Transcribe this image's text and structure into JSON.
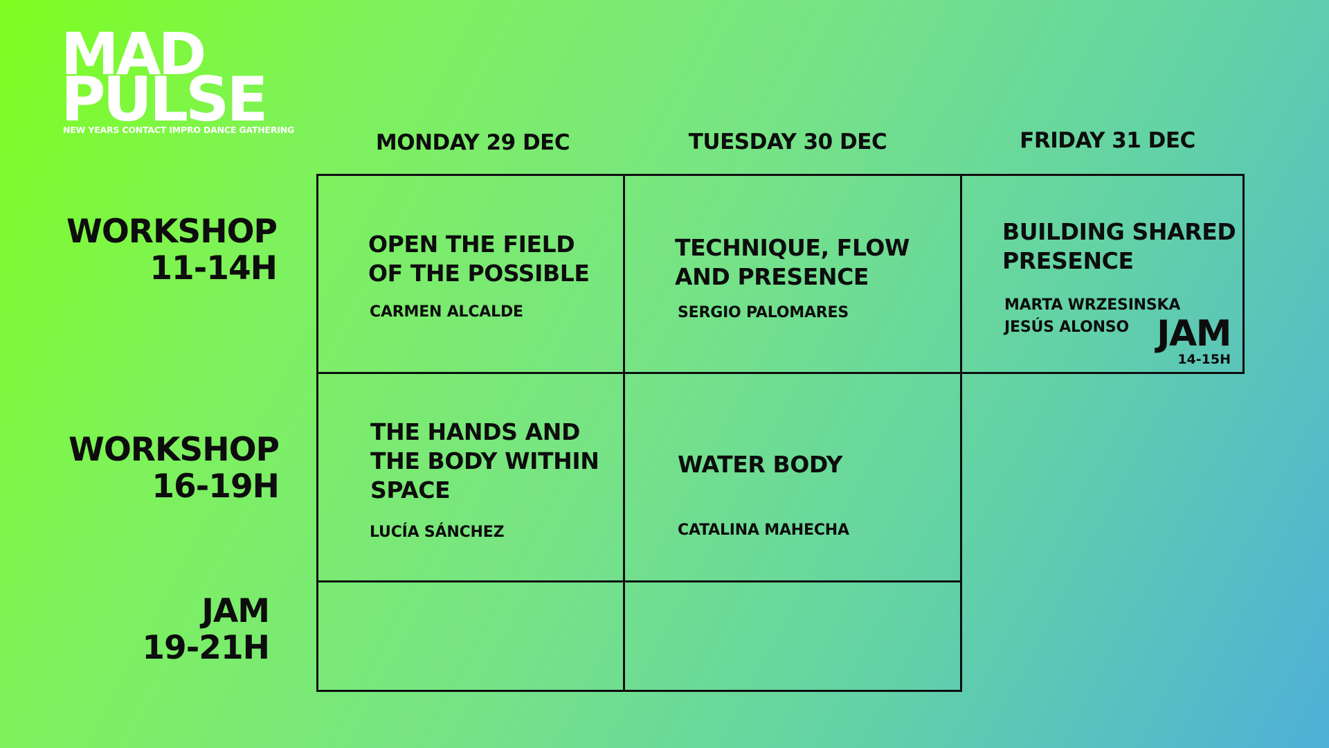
{
  "logo": {
    "line1": "MAD",
    "line2": "PULSE",
    "tagline": "NEW YEARS CONTACT IMPRO DANCE GATHERING"
  },
  "days": [
    "MONDAY 29 DEC",
    "TUESDAY 30 DEC",
    "FRIDAY 31 DEC"
  ],
  "rows": [
    {
      "label": "WORKSHOP",
      "time": "11-14H"
    },
    {
      "label": "WORKSHOP",
      "time": "16-19H"
    },
    {
      "label": "JAM",
      "time": "19-21H"
    }
  ],
  "sessions": {
    "mon_morning": {
      "title_lines": [
        "OPEN THE FIELD",
        "OF THE POSSIBLE"
      ],
      "facilitators": [
        "CARMEN ALCALDE"
      ]
    },
    "tue_morning": {
      "title_lines": [
        "TECHNIQUE, FLOW",
        "AND PRESENCE"
      ],
      "facilitators": [
        "SERGIO PALOMARES"
      ]
    },
    "fri_morning": {
      "title_lines": [
        "BUILDING SHARED",
        "PRESENCE"
      ],
      "facilitators": [
        "MARTA WRZESINSKA",
        "JESÚS ALONSO"
      ],
      "jam_label": "JAM",
      "jam_time": "14-15H"
    },
    "mon_afternoon": {
      "title_lines": [
        "THE HANDS AND",
        "THE BODY WITHIN",
        "SPACE"
      ],
      "facilitators": [
        "LUCÍA SÁNCHEZ"
      ]
    },
    "tue_afternoon": {
      "title_lines": [
        "WATER BODY"
      ],
      "facilitators": [
        "CATALINA MAHECHA"
      ]
    }
  },
  "colors": {
    "gradient_start": "#7dfd1f",
    "gradient_end": "#4fb0d8",
    "text": "#0d0d0d",
    "logo": "#ffffff"
  }
}
